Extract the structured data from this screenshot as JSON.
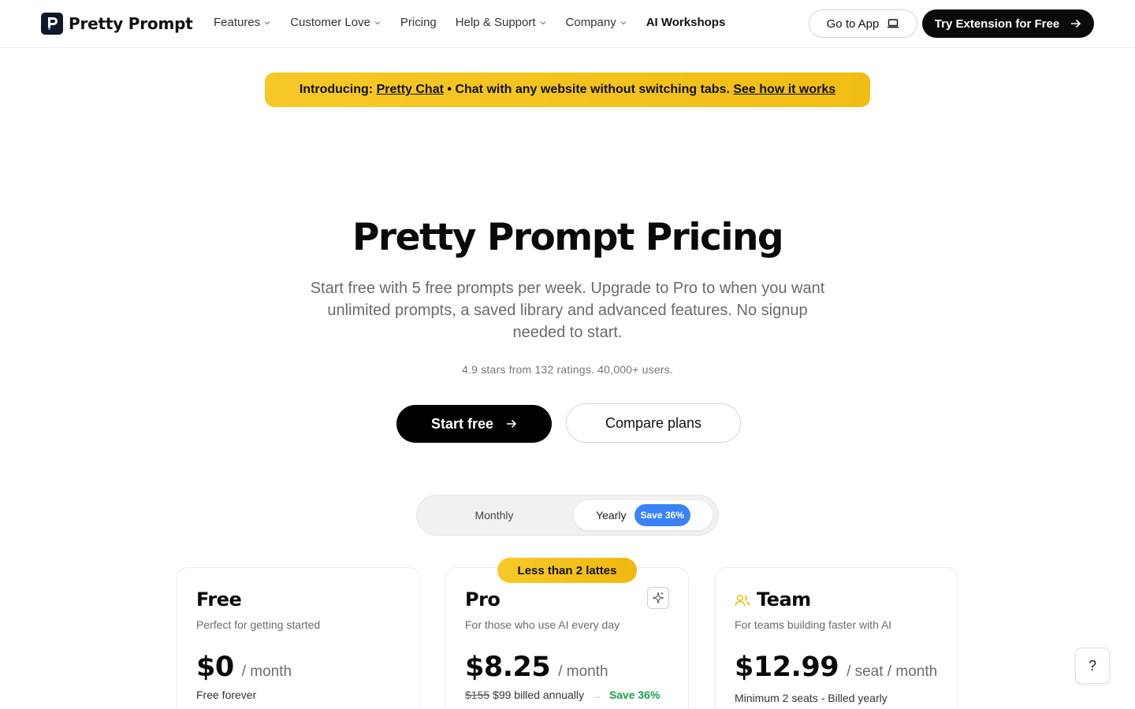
{
  "header": {
    "brand": "Pretty Prompt",
    "nav": [
      {
        "label": "Features",
        "dropdown": true
      },
      {
        "label": "Customer Love",
        "dropdown": true
      },
      {
        "label": "Pricing",
        "dropdown": false
      },
      {
        "label": "Help & Support",
        "dropdown": true
      },
      {
        "label": "Company",
        "dropdown": true
      },
      {
        "label": "AI Workshops",
        "dropdown": false
      }
    ],
    "go_to_app": "Go to App",
    "try_extension": "Try Extension for Free"
  },
  "announcement": {
    "prefix": "Introducing:",
    "product": "Pretty Chat",
    "message": "• Chat with any website without switching tabs.",
    "cta": "See how it works"
  },
  "hero": {
    "title": "Pretty Prompt Pricing",
    "subtitle": "Start free with 5 free prompts per week. Upgrade to Pro to when you want unlimited prompts, a saved library and advanced features. No signup needed to start.",
    "rating": "4.9 stars from 132 ratings. 40,000+ users.",
    "start_free": "Start free",
    "compare_plans": "Compare plans"
  },
  "billing_toggle": {
    "monthly": "Monthly",
    "yearly": "Yearly",
    "save_badge": "Save 36%",
    "selected": "Yearly"
  },
  "plans": {
    "free": {
      "name": "Free",
      "description": "Perfect for getting started",
      "price": "$0",
      "unit": "/ month",
      "note": "Free forever"
    },
    "pro": {
      "badge": "Less than 2 lattes",
      "name": "Pro",
      "description": "For those who use AI every day",
      "price": "$8.25",
      "unit": "/ month",
      "original_price": "$155",
      "billed": "$99 billed annually",
      "arrow": "→",
      "save": "Save 36%"
    },
    "team": {
      "name": "Team",
      "description": "For teams building faster with AI",
      "price": "$12.99",
      "unit": "/ seat / month",
      "note": "Minimum 2 seats - Billed yearly"
    }
  },
  "help_button": "?",
  "colors": {
    "accent_yellow": "#f5c518",
    "save_blue": "#3b82f6",
    "save_green": "#16a34a",
    "dark": "#0a0a0a"
  }
}
